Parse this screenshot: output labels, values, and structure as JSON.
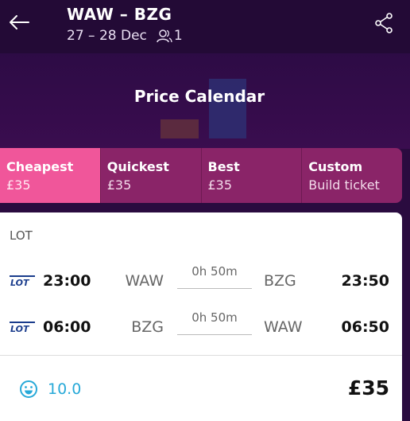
{
  "header": {
    "route": "WAW – BZG",
    "dates": "27 – 28 Dec",
    "passengers": "1",
    "icons": [
      "arrow-left-icon",
      "person-icon",
      "share-icon"
    ]
  },
  "hero": {
    "title": "Price Calendar"
  },
  "tabs": [
    {
      "label": "Cheapest",
      "value": "£35",
      "active": true
    },
    {
      "label": "Quickest",
      "value": "£35",
      "active": false
    },
    {
      "label": "Best",
      "value": "£35",
      "active": false
    },
    {
      "label": "Custom",
      "value": "Build ticket",
      "active": false
    }
  ],
  "result": {
    "airline": "LOT",
    "legs": [
      {
        "logo": "LOT",
        "dep_time": "23:00",
        "from": "WAW",
        "duration": "0h 50m",
        "to": "BZG",
        "arr_time": "23:50"
      },
      {
        "logo": "LOT",
        "dep_time": "06:00",
        "from": "BZG",
        "duration": "0h 50m",
        "to": "WAW",
        "arr_time": "06:50"
      }
    ],
    "score": "10.0",
    "price": "£35"
  },
  "colors": {
    "header_bg": "#230a36",
    "tab_bg": "#8a2468",
    "tab_active": "#f0569a",
    "score": "#27a9d8"
  }
}
